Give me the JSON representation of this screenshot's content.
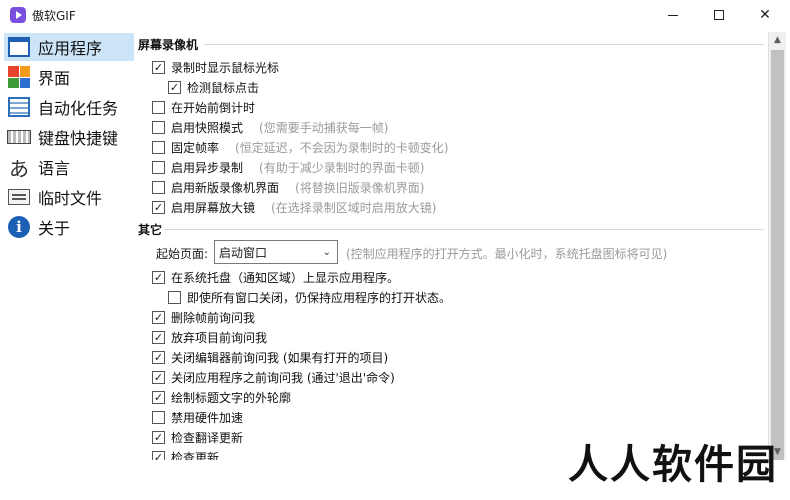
{
  "window": {
    "title": "傲软GIF"
  },
  "sidebar": {
    "items": [
      {
        "label": "应用程序",
        "icon": "app-window-icon",
        "active": true
      },
      {
        "label": "界面",
        "icon": "color-grid-icon"
      },
      {
        "label": "自动化任务",
        "icon": "automation-list-icon"
      },
      {
        "label": "键盘快捷键",
        "icon": "keyboard-icon"
      },
      {
        "label": "语言",
        "icon": "language-icon"
      },
      {
        "label": "临时文件",
        "icon": "temp-files-icon"
      },
      {
        "label": "关于",
        "icon": "info-icon"
      }
    ]
  },
  "recording": {
    "title": "屏幕录像机",
    "options": [
      {
        "label": "录制时显示鼠标光标",
        "checked": true,
        "hint": ""
      },
      {
        "label": "检测鼠标点击",
        "checked": true,
        "hint": ""
      },
      {
        "label": "在开始前倒计时",
        "checked": false,
        "hint": ""
      },
      {
        "label": "启用快照模式",
        "checked": false,
        "hint": "(您需要手动捕获每一帧)"
      },
      {
        "label": "固定帧率",
        "checked": false,
        "hint": "(恒定延迟，不会因为录制时的卡顿变化)"
      },
      {
        "label": "启用异步录制",
        "checked": false,
        "hint": "(有助于减少录制时的界面卡顿)"
      },
      {
        "label": "启用新版录像机界面",
        "checked": false,
        "hint": "(将替换旧版录像机界面)"
      },
      {
        "label": "启用屏幕放大镜",
        "checked": true,
        "hint": "(在选择录制区域时启用放大镜)"
      }
    ]
  },
  "other": {
    "title": "其它",
    "startup_label": "起始页面:",
    "startup_value": "启动窗口",
    "startup_hint": "(控制应用程序的打开方式。最小化时，系统托盘图标将可见)",
    "options": [
      {
        "label": "在系统托盘（通知区域）上显示应用程序。",
        "checked": true
      },
      {
        "label": "即使所有窗口关闭，仍保持应用程序的打开状态。",
        "checked": false
      },
      {
        "label": "删除帧前询问我",
        "checked": true
      },
      {
        "label": "放弃项目前询问我",
        "checked": true
      },
      {
        "label": "关闭编辑器前询问我  (如果有打开的项目)",
        "checked": true
      },
      {
        "label": "关闭应用程序之前询问我  (通过'退出'命令)",
        "checked": true
      },
      {
        "label": "绘制标题文字的外轮廓",
        "checked": true
      },
      {
        "label": "禁用硬件加速",
        "checked": false
      },
      {
        "label": "检查翻译更新",
        "checked": true
      },
      {
        "label": "检查更新",
        "checked": true
      }
    ]
  },
  "watermark": "人人软件园",
  "colors": {
    "accent": "#1a5fb4",
    "selected_bg": "#cce4f7",
    "hint": "#9a9a9a"
  }
}
